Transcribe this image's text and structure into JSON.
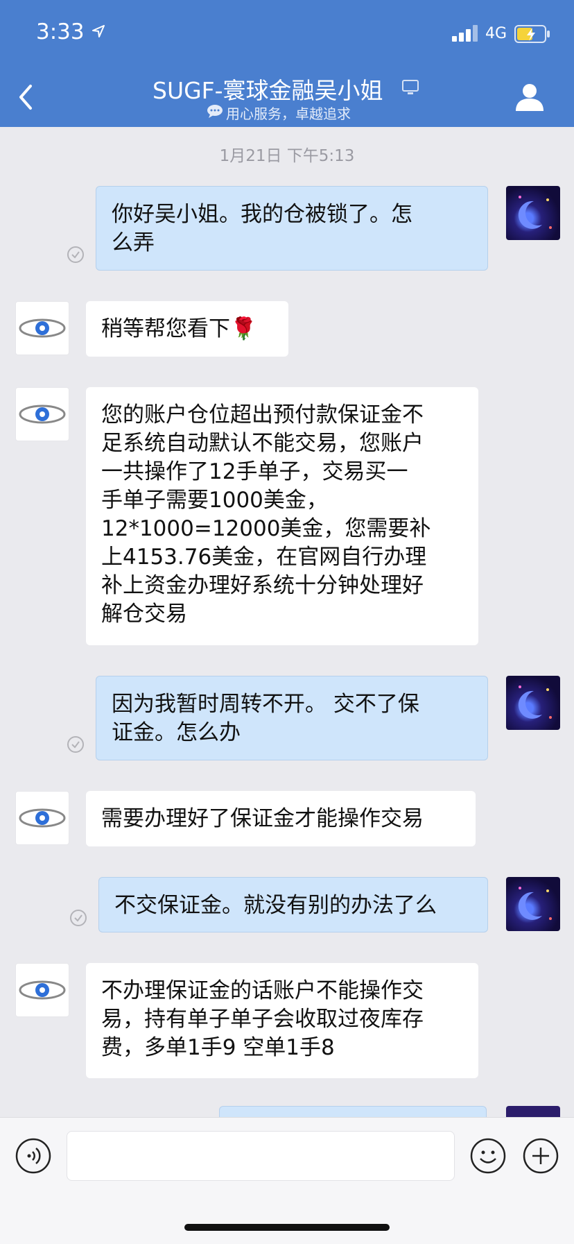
{
  "status_bar": {
    "time": "3:33",
    "network": "4G"
  },
  "header": {
    "title": "SUGF-寰球金融吴小姐",
    "subtitle": "用心服务，卓越追求"
  },
  "chat": {
    "timestamp": "1月21日 下午5:13",
    "messages": [
      {
        "side": "out",
        "lines": [
          "你好吴小姐。我的仓被锁了。怎",
          "么弄"
        ]
      },
      {
        "side": "in",
        "lines": [
          "稍等帮您看下🌹"
        ]
      },
      {
        "side": "in",
        "lines": [
          "您的账户仓位超出预付款保证金不",
          "足系统自动默认不能交易，您账户",
          "一共操作了12手单子，交易买一",
          "手单子需要1000美金，",
          "12*1000=12000美金，您需要补",
          "上4153.76美金，在官网自行办理",
          "补上资金办理好系统十分钟处理好",
          "解仓交易"
        ]
      },
      {
        "side": "out",
        "lines": [
          "因为我暂时周转不开。 交不了保",
          "证金。怎么办"
        ]
      },
      {
        "side": "in",
        "lines": [
          "需要办理好了保证金才能操作交易"
        ]
      },
      {
        "side": "out",
        "lines": [
          "不交保证金。就没有别的办法了么"
        ]
      },
      {
        "side": "in",
        "lines": [
          "不办理保证金的话账户不能操作交",
          "易，持有单子单子会收取过夜库存",
          "费，多单1手9 空单1手8"
        ]
      }
    ]
  },
  "input": {
    "placeholder": ""
  },
  "colors": {
    "header_bg": "#4a7fcf",
    "outgoing_bubble": "#cfe5fb",
    "incoming_bubble": "#ffffff",
    "chat_bg": "#eaeaee"
  },
  "icons": [
    "location-arrow-icon",
    "signal-icon",
    "battery-icon",
    "back-chevron-icon",
    "computer-icon",
    "chat-bubble-icon",
    "profile-icon",
    "read-check-icon",
    "voice-icon",
    "emoji-icon",
    "plus-icon"
  ]
}
